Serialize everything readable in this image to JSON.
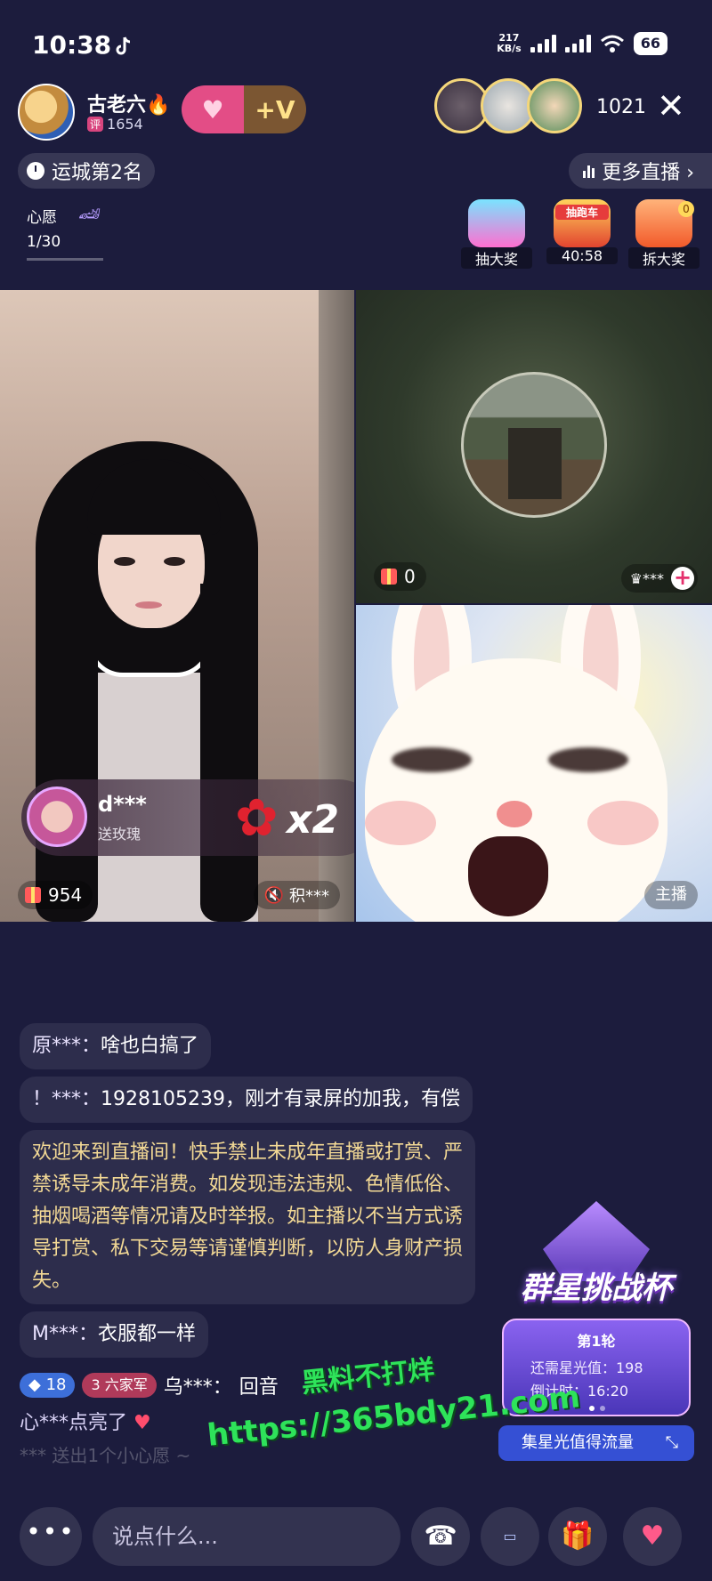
{
  "status_bar": {
    "time": "10:38",
    "net_speed_top": "217",
    "net_speed_bottom": "KB/s",
    "battery": "66"
  },
  "host": {
    "name": "古老六🔥",
    "badge": "评",
    "followers": "1654",
    "follow_heart": "♥",
    "follow_v": "+V"
  },
  "viewers": {
    "count": "1021"
  },
  "close_label": "✕",
  "rank": {
    "label": "运城第2名"
  },
  "more_live": {
    "label": "更多直播 ›"
  },
  "wish": {
    "label": "心愿",
    "progress": "1/30",
    "progress_fraction": 0.033
  },
  "activities": [
    {
      "label": "抽大奖"
    },
    {
      "tag": "抽跑车",
      "label": "40:58"
    },
    {
      "label": "拆大奖",
      "badge": "0"
    }
  ],
  "left_panel": {
    "gift_count": "954",
    "mute_label": "积***",
    "gift_banner": {
      "name": "d***",
      "action": "送玫瑰",
      "multiplier": "x2"
    }
  },
  "top_right_panel": {
    "gift_count": "0",
    "user": "♛***"
  },
  "bottom_right_panel": {
    "tag": "主播"
  },
  "chat": {
    "messages": [
      {
        "user": "原***：",
        "text": "啥也白搞了"
      },
      {
        "user": "！***：",
        "text": "1928105239，刚才有录屏的加我，有偿"
      }
    ],
    "system_notice": "欢迎来到直播间！快手禁止未成年直播或打赏、严禁诱导未成年消费。如发现违法违规、色情低俗、抽烟喝酒等情况请及时举报。如主播以不当方式诱导打赏、私下交易等请谨慎判断，以防人身财产损失。",
    "message3": {
      "user": "M***：",
      "text": "衣服都一样"
    },
    "badge_row": {
      "level": "18",
      "army": "六家军",
      "army_level": "3",
      "user": "乌***：",
      "text": "回音"
    },
    "lit_row": {
      "text": "心***点亮了",
      "heart": "♥"
    },
    "faded_row": "***  送出1个小心愿 ~"
  },
  "cup": {
    "title": "群星挑战杯",
    "round": "第1轮",
    "need_label": "还需星光值：198",
    "timer_label": "倒计时：16:20",
    "button": "集星光值得流量"
  },
  "watermark": {
    "line1": "黑料不打烊",
    "line2": "https://365bdy21.com"
  },
  "bottom_bar": {
    "more": "•••",
    "input_placeholder": "说点什么...",
    "call_icon": "☎",
    "gift_icon": "🎁",
    "like_icon": "♥"
  },
  "colors": {
    "background": "#1c1c3d",
    "accent_pink": "#e34d86",
    "notice_yellow": "#f3d995",
    "watermark_green": "#2ee35a"
  }
}
